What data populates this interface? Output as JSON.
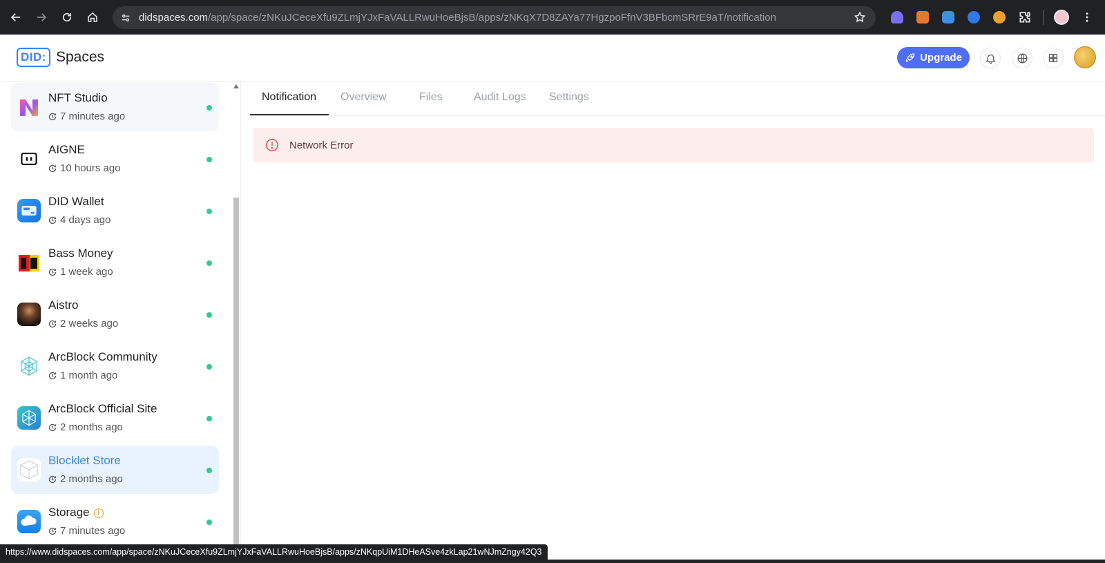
{
  "browser": {
    "url_host": "didspaces.com",
    "url_path": "/app/space/zNKuJCeceXfu9ZLmjYJxFaVALLRwuHoeBjsB/apps/zNKqX7D8ZAYa77HgzpoFfnV3BFbcmSRrE9aT/notification",
    "status_url": "https://www.didspaces.com/app/space/zNKuJCeceXfu9ZLmjYJxFaVALLRwuHoeBjsB/apps/zNKqpUiM1DHeASve4zkLap21wNJmZngy42Q3",
    "extensions": [
      "ghost-extension",
      "fox-extension",
      "wallet-extension",
      "chat-extension",
      "swirl-extension",
      "puzzle-extension"
    ]
  },
  "header": {
    "logo_did": "DID:",
    "logo_name": "Spaces",
    "upgrade_label": "Upgrade"
  },
  "sidebar": {
    "items": [
      {
        "title": "NFT Studio",
        "time": "7 minutes ago",
        "icon": "nft-studio-icon",
        "state": "hover"
      },
      {
        "title": "AIGNE",
        "time": "10 hours ago",
        "icon": "aigne-icon",
        "state": ""
      },
      {
        "title": "DID Wallet",
        "time": "4 days ago",
        "icon": "did-wallet-icon",
        "state": ""
      },
      {
        "title": "Bass Money",
        "time": "1 week ago",
        "icon": "bass-money-icon",
        "state": ""
      },
      {
        "title": "Aistro",
        "time": "2 weeks ago",
        "icon": "aistro-icon",
        "state": ""
      },
      {
        "title": "ArcBlock Community",
        "time": "1 month ago",
        "icon": "arcblock-community-icon",
        "state": ""
      },
      {
        "title": "ArcBlock Official Site",
        "time": "2 months ago",
        "icon": "arcblock-official-icon",
        "state": ""
      },
      {
        "title": "Blocklet Store",
        "time": "2 months ago",
        "icon": "blocklet-store-icon",
        "state": "selected"
      },
      {
        "title": "Storage",
        "time": "7 minutes ago",
        "icon": "storage-icon",
        "state": "",
        "info_badge": "i"
      }
    ]
  },
  "tabs": [
    "Notification",
    "Overview",
    "Files",
    "Audit Logs",
    "Settings"
  ],
  "active_tab": "Notification",
  "alert": {
    "text": "Network Error",
    "severity": "error",
    "color": "#e05a5a"
  },
  "colors": {
    "accent": "#4f6ef7",
    "status_online": "#2ecc8f",
    "selected_text": "#3a8bd8"
  }
}
